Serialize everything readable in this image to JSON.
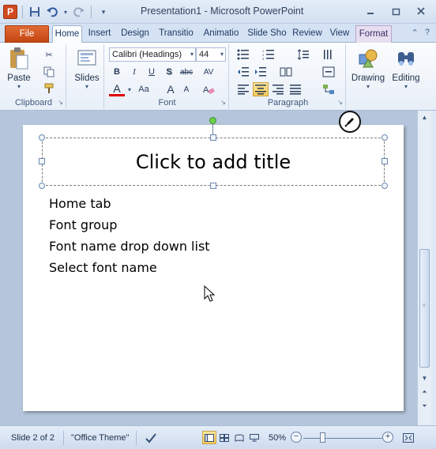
{
  "window": {
    "title": "Presentation1  -  Microsoft PowerPoint",
    "app_logo": "P",
    "controls": [
      "minimize-icon",
      "restore-icon",
      "close-icon"
    ]
  },
  "quick_access": {
    "icons": [
      "save-icon",
      "undo-icon",
      "redo-icon",
      "customize-icon"
    ]
  },
  "tabs": {
    "file": "File",
    "items": [
      "Home",
      "Insert",
      "Design",
      "Transitio",
      "Animatio",
      "Slide Sho",
      "Review",
      "View",
      "Format"
    ],
    "active": "Home"
  },
  "ribbon": {
    "clipboard": {
      "label": "Clipboard",
      "paste": "Paste"
    },
    "slides": {
      "label": "Slides"
    },
    "font": {
      "label": "Font",
      "font_name": "Calibri (Headings)",
      "font_size": "44",
      "bold": "B",
      "italic": "I",
      "underline": "U",
      "shadow": "S",
      "strikethrough": "abc",
      "spacing": "AV",
      "font_color": "A",
      "change_case": "Aa",
      "grow": "A",
      "shrink": "A"
    },
    "paragraph": {
      "label": "Paragraph"
    },
    "drawing": {
      "label": "Drawing"
    },
    "editing": {
      "label": "Editing"
    }
  },
  "slide": {
    "title_placeholder": "Click to add title",
    "body_lines": [
      "Home tab",
      "Font group",
      "Font name drop down list",
      "Select font name"
    ]
  },
  "statusbar": {
    "slide_info": "Slide 2 of 2",
    "theme": "\"Office Theme\"",
    "zoom": "50%",
    "zoom_minus": "−",
    "zoom_plus": "+",
    "zoom_level": 0.5
  },
  "colors": {
    "file_tab": "#c44511",
    "active_view": "#f6c955",
    "font_color_bar": "#e00000",
    "rotate_handle": "#6cd14a"
  }
}
